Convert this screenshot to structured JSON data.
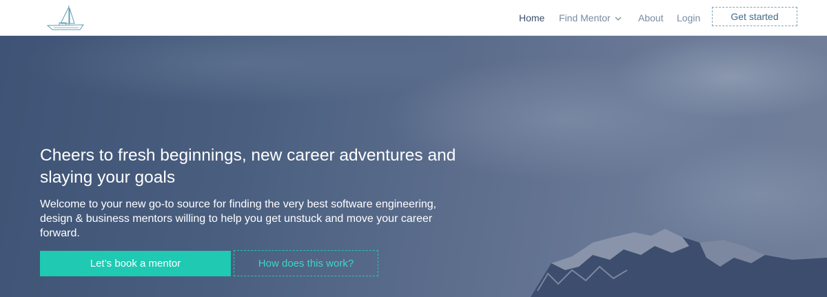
{
  "nav": {
    "logo_icon": "sailboat-icon",
    "items": [
      {
        "label": "Home",
        "active": true
      },
      {
        "label": "Find Mentor",
        "has_dropdown": true
      },
      {
        "label": "About"
      },
      {
        "label": "Login"
      }
    ],
    "cta_label": "Get started"
  },
  "hero": {
    "headline": "Cheers to fresh beginnings, new career adventures and slaying your goals",
    "subtext": "Welcome to your new go-to source for finding the very best software engineering, design & business mentors willing to help you get unstuck and move your career forward.",
    "primary_button": "Let’s book a mentor",
    "secondary_button": "How does this work?"
  },
  "colors": {
    "accent": "#1fc9b2",
    "hero_overlay": "#4a5f80",
    "nav_text": "#7b8aa3",
    "nav_active": "#3b4f6e"
  }
}
